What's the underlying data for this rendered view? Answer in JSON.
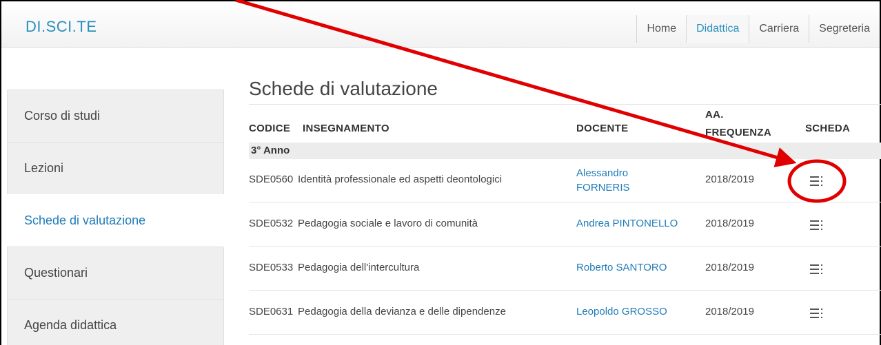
{
  "navbar": {
    "brand": "DI.SCI.TE",
    "items": [
      {
        "label": "Home",
        "active": false
      },
      {
        "label": "Didattica",
        "active": true
      },
      {
        "label": "Carriera",
        "active": false
      },
      {
        "label": "Segreteria",
        "active": false
      }
    ]
  },
  "sidebar": {
    "items": [
      {
        "label": "Corso di studi",
        "active": false
      },
      {
        "label": "Lezioni",
        "active": false
      },
      {
        "label": "Schede di valutazione",
        "active": true
      },
      {
        "label": "Questionari",
        "active": false
      },
      {
        "label": "Agenda didattica",
        "active": false
      }
    ]
  },
  "main": {
    "title": "Schede di valutazione",
    "headers": {
      "codice": "CODICE",
      "insegnamento": "INSEGNAMENTO",
      "docente": "DOCENTE",
      "aa_line1": "AA.",
      "aa_line2": "FREQUENZA",
      "scheda": "SCHEDA"
    },
    "group_label": "3° Anno",
    "rows": [
      {
        "code": "SDE0560",
        "course": "Identità professionale ed aspetti deontologici",
        "teacher_line1": "Alessandro",
        "teacher_line2": "FORNERIS",
        "year": "2018/2019",
        "icon": "list-icon"
      },
      {
        "code": "SDE0532",
        "course": "Pedagogia sociale e lavoro di comunità",
        "teacher_line1": "Andrea PINTONELLO",
        "teacher_line2": "",
        "year": "2018/2019",
        "icon": "list-icon"
      },
      {
        "code": "SDE0533",
        "course": "Pedagogia dell'intercultura",
        "teacher_line1": "Roberto SANTORO",
        "teacher_line2": "",
        "year": "2018/2019",
        "icon": "list-icon"
      },
      {
        "code": "SDE0631",
        "course": "Pedagogia della devianza e delle dipendenze",
        "teacher_line1": "Leopoldo GROSSO",
        "teacher_line2": "",
        "year": "2018/2019",
        "icon": "list-icon"
      }
    ]
  },
  "colors": {
    "link": "#1f7bb8",
    "brand": "#2a8fbd",
    "annotation": "#e00000"
  }
}
